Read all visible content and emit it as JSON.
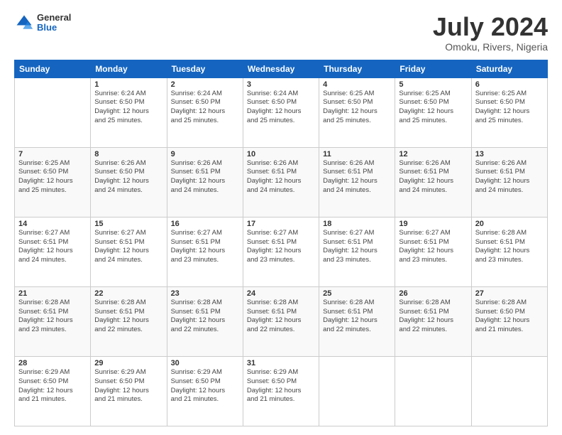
{
  "header": {
    "logo": {
      "general": "General",
      "blue": "Blue"
    },
    "title": "July 2024",
    "location": "Omoku, Rivers, Nigeria"
  },
  "days_of_week": [
    "Sunday",
    "Monday",
    "Tuesday",
    "Wednesday",
    "Thursday",
    "Friday",
    "Saturday"
  ],
  "weeks": [
    [
      {
        "day": "",
        "info": ""
      },
      {
        "day": "1",
        "info": "Sunrise: 6:24 AM\nSunset: 6:50 PM\nDaylight: 12 hours\nand 25 minutes."
      },
      {
        "day": "2",
        "info": "Sunrise: 6:24 AM\nSunset: 6:50 PM\nDaylight: 12 hours\nand 25 minutes."
      },
      {
        "day": "3",
        "info": "Sunrise: 6:24 AM\nSunset: 6:50 PM\nDaylight: 12 hours\nand 25 minutes."
      },
      {
        "day": "4",
        "info": "Sunrise: 6:25 AM\nSunset: 6:50 PM\nDaylight: 12 hours\nand 25 minutes."
      },
      {
        "day": "5",
        "info": "Sunrise: 6:25 AM\nSunset: 6:50 PM\nDaylight: 12 hours\nand 25 minutes."
      },
      {
        "day": "6",
        "info": "Sunrise: 6:25 AM\nSunset: 6:50 PM\nDaylight: 12 hours\nand 25 minutes."
      }
    ],
    [
      {
        "day": "7",
        "info": "Sunrise: 6:25 AM\nSunset: 6:50 PM\nDaylight: 12 hours\nand 25 minutes."
      },
      {
        "day": "8",
        "info": "Sunrise: 6:26 AM\nSunset: 6:50 PM\nDaylight: 12 hours\nand 24 minutes."
      },
      {
        "day": "9",
        "info": "Sunrise: 6:26 AM\nSunset: 6:51 PM\nDaylight: 12 hours\nand 24 minutes."
      },
      {
        "day": "10",
        "info": "Sunrise: 6:26 AM\nSunset: 6:51 PM\nDaylight: 12 hours\nand 24 minutes."
      },
      {
        "day": "11",
        "info": "Sunrise: 6:26 AM\nSunset: 6:51 PM\nDaylight: 12 hours\nand 24 minutes."
      },
      {
        "day": "12",
        "info": "Sunrise: 6:26 AM\nSunset: 6:51 PM\nDaylight: 12 hours\nand 24 minutes."
      },
      {
        "day": "13",
        "info": "Sunrise: 6:26 AM\nSunset: 6:51 PM\nDaylight: 12 hours\nand 24 minutes."
      }
    ],
    [
      {
        "day": "14",
        "info": "Sunrise: 6:27 AM\nSunset: 6:51 PM\nDaylight: 12 hours\nand 24 minutes."
      },
      {
        "day": "15",
        "info": "Sunrise: 6:27 AM\nSunset: 6:51 PM\nDaylight: 12 hours\nand 24 minutes."
      },
      {
        "day": "16",
        "info": "Sunrise: 6:27 AM\nSunset: 6:51 PM\nDaylight: 12 hours\nand 23 minutes."
      },
      {
        "day": "17",
        "info": "Sunrise: 6:27 AM\nSunset: 6:51 PM\nDaylight: 12 hours\nand 23 minutes."
      },
      {
        "day": "18",
        "info": "Sunrise: 6:27 AM\nSunset: 6:51 PM\nDaylight: 12 hours\nand 23 minutes."
      },
      {
        "day": "19",
        "info": "Sunrise: 6:27 AM\nSunset: 6:51 PM\nDaylight: 12 hours\nand 23 minutes."
      },
      {
        "day": "20",
        "info": "Sunrise: 6:28 AM\nSunset: 6:51 PM\nDaylight: 12 hours\nand 23 minutes."
      }
    ],
    [
      {
        "day": "21",
        "info": "Sunrise: 6:28 AM\nSunset: 6:51 PM\nDaylight: 12 hours\nand 23 minutes."
      },
      {
        "day": "22",
        "info": "Sunrise: 6:28 AM\nSunset: 6:51 PM\nDaylight: 12 hours\nand 22 minutes."
      },
      {
        "day": "23",
        "info": "Sunrise: 6:28 AM\nSunset: 6:51 PM\nDaylight: 12 hours\nand 22 minutes."
      },
      {
        "day": "24",
        "info": "Sunrise: 6:28 AM\nSunset: 6:51 PM\nDaylight: 12 hours\nand 22 minutes."
      },
      {
        "day": "25",
        "info": "Sunrise: 6:28 AM\nSunset: 6:51 PM\nDaylight: 12 hours\nand 22 minutes."
      },
      {
        "day": "26",
        "info": "Sunrise: 6:28 AM\nSunset: 6:51 PM\nDaylight: 12 hours\nand 22 minutes."
      },
      {
        "day": "27",
        "info": "Sunrise: 6:28 AM\nSunset: 6:50 PM\nDaylight: 12 hours\nand 21 minutes."
      }
    ],
    [
      {
        "day": "28",
        "info": "Sunrise: 6:29 AM\nSunset: 6:50 PM\nDaylight: 12 hours\nand 21 minutes."
      },
      {
        "day": "29",
        "info": "Sunrise: 6:29 AM\nSunset: 6:50 PM\nDaylight: 12 hours\nand 21 minutes."
      },
      {
        "day": "30",
        "info": "Sunrise: 6:29 AM\nSunset: 6:50 PM\nDaylight: 12 hours\nand 21 minutes."
      },
      {
        "day": "31",
        "info": "Sunrise: 6:29 AM\nSunset: 6:50 PM\nDaylight: 12 hours\nand 21 minutes."
      },
      {
        "day": "",
        "info": ""
      },
      {
        "day": "",
        "info": ""
      },
      {
        "day": "",
        "info": ""
      }
    ]
  ]
}
